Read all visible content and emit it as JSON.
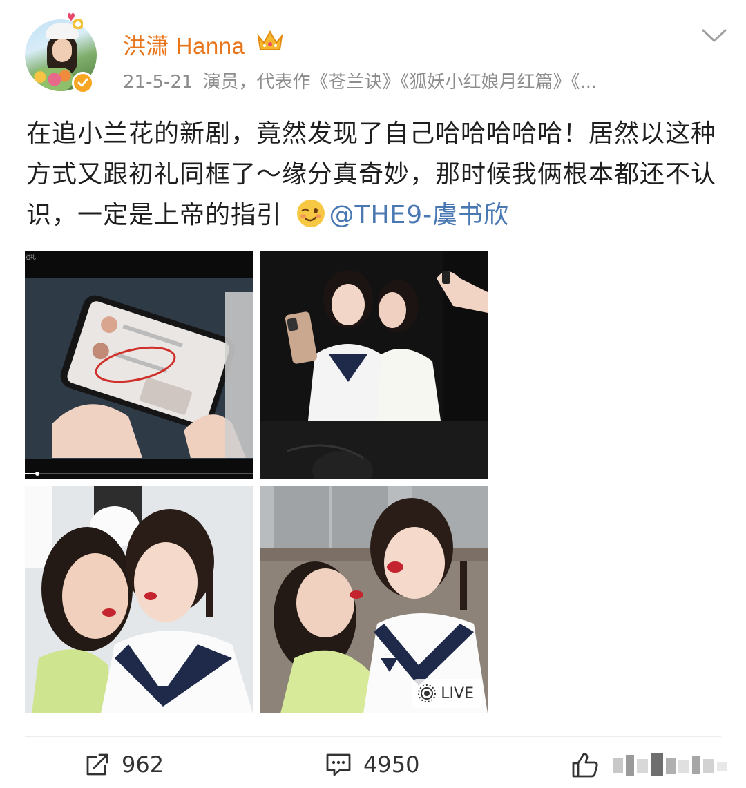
{
  "post": {
    "author": "洪潇 Hanna",
    "date": "21-5-21",
    "bio": "演员，代表作《苍兰诀》《狐妖小红娘月红篇》《...",
    "text_part1": "在追小兰花的新剧，竟然发现了自己哈哈哈哈哈！居然以这种方式又跟初礼同框了～缘分真奇妙，那时候我俩根本都还不认识，一定是上帝的指引",
    "mention": "@THE9-虞书欣"
  },
  "photos": {
    "live_label": "LIVE",
    "caption_tiny": "初礼"
  },
  "actions": {
    "reposts": "962",
    "comments": "4950"
  },
  "colors": {
    "username": "#e8751a",
    "mention": "#4a78b3",
    "meta": "#8c8c8c",
    "verified": "#f6a623"
  },
  "icons": [
    "crown-icon",
    "verified-icon",
    "chevron-down-icon",
    "wink-emoji-icon",
    "live-photo-icon",
    "repost-icon",
    "comment-icon",
    "like-icon"
  ]
}
